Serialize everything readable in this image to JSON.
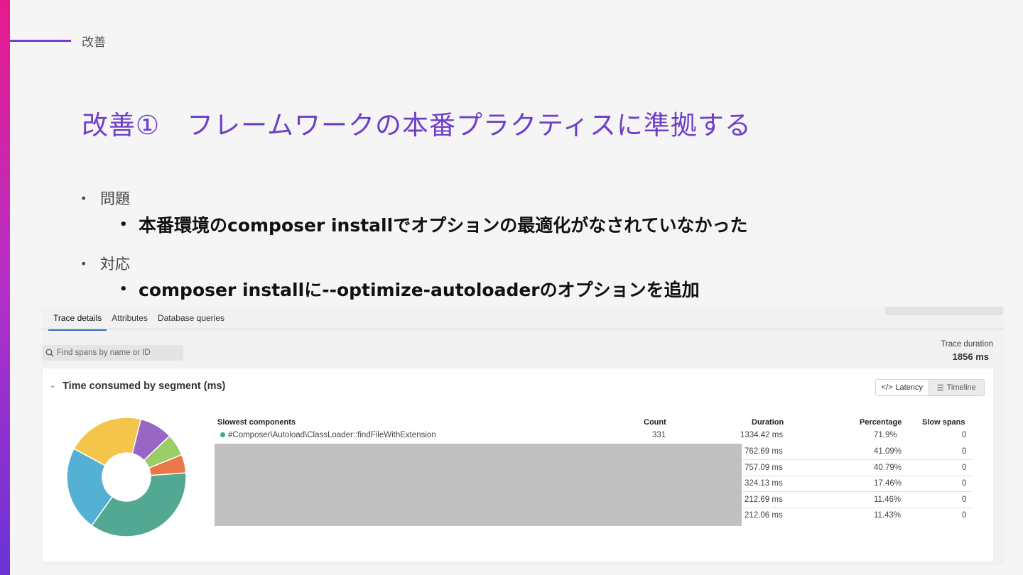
{
  "slide": {
    "section_label": "改善",
    "title": "改善①　フレームワークの本番プラクティスに準拠する",
    "bullets": {
      "problem_label": "問題",
      "problem_detail": "本番環境のcomposer installでオプションの最適化がなされていなかった",
      "fix_label": "対応",
      "fix_detail": "composer installに--optimize-autoloaderのオプションを追加"
    }
  },
  "screenshot": {
    "tabs": [
      "Trace details",
      "Attributes",
      "Database queries"
    ],
    "search_placeholder": "Find spans by name or ID",
    "trace_duration_label": "Trace duration",
    "trace_duration_value": "1856 ms",
    "segment_title": "Time consumed by segment (ms)",
    "toggle": {
      "latency": "Latency",
      "timeline": "Timeline"
    },
    "table": {
      "headers": {
        "component": "Slowest components",
        "count": "Count",
        "duration": "Duration",
        "percentage": "Percentage",
        "slow_spans": "Slow spans"
      },
      "rows": [
        {
          "component": "#Composer\\Autoload\\ClassLoader::findFileWithExtension",
          "count": "331",
          "duration": "1334.42 ms",
          "percentage": "71.9%",
          "slow_spans": "0"
        },
        {
          "duration": "762.69 ms",
          "percentage": "41.09%",
          "slow_spans": "0"
        },
        {
          "duration": "757.09 ms",
          "percentage": "40.79%",
          "slow_spans": "0"
        },
        {
          "duration": "324.13 ms",
          "percentage": "17.46%",
          "slow_spans": "0"
        },
        {
          "duration": "212.69 ms",
          "percentage": "11.46%",
          "slow_spans": "0"
        },
        {
          "duration": "212.06 ms",
          "percentage": "11.43%",
          "slow_spans": "0"
        }
      ]
    },
    "donut_segments": [
      {
        "value": 36,
        "color": "#52a891"
      },
      {
        "value": 23,
        "color": "#55b1d3"
      },
      {
        "value": 21,
        "color": "#f4c54a"
      },
      {
        "value": 9,
        "color": "#9966c6"
      },
      {
        "value": 6,
        "color": "#9acd65"
      },
      {
        "value": 5,
        "color": "#ea7748"
      }
    ],
    "colors": {
      "accent_tab": "#3a6fc4",
      "redaction": "#c0c0c0"
    }
  }
}
